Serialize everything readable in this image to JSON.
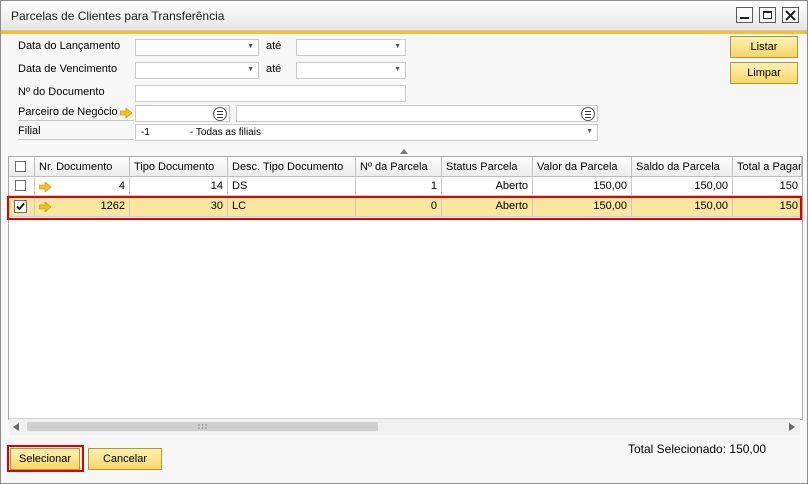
{
  "window": {
    "title": "Parcelas de Clientes para Transferência"
  },
  "filters": {
    "data_lancamento_label": "Data do Lançamento",
    "data_vencimento_label": "Data de Vencimento",
    "ate_label": "até",
    "num_documento_label": "Nº do Documento",
    "parceiro_label": "Parceiro de Negócio",
    "filial_label": "Filial",
    "filial_code": "-1",
    "filial_desc": "- Todas as filiais"
  },
  "buttons": {
    "listar": "Listar",
    "limpar": "Limpar",
    "selecionar": "Selecionar",
    "cancelar": "Cancelar"
  },
  "grid": {
    "columns": [
      "Nr. Documento",
      "Tipo Documento",
      "Desc. Tipo Documento",
      "Nº da Parcela",
      "Status Parcela",
      "Valor da Parcela",
      "Saldo da Parcela",
      "Total a Pagar"
    ],
    "rows": [
      {
        "checked": false,
        "nr_documento": "4",
        "tipo_documento": "14",
        "desc_tipo": "DS",
        "parcela": "1",
        "status": "Aberto",
        "valor": "150,00",
        "saldo": "150,00",
        "total": "150"
      },
      {
        "checked": true,
        "nr_documento": "1262",
        "tipo_documento": "30",
        "desc_tipo": "LC",
        "parcela": "0",
        "status": "Aberto",
        "valor": "150,00",
        "saldo": "150,00",
        "total": "150"
      }
    ]
  },
  "footer": {
    "total_label": "Total Selecionado: 150,00"
  },
  "colors": {
    "accent": "#f3c32b",
    "selected_row": "#fbe6a0",
    "highlight_border": "#e00000",
    "button": "#f4d766"
  }
}
